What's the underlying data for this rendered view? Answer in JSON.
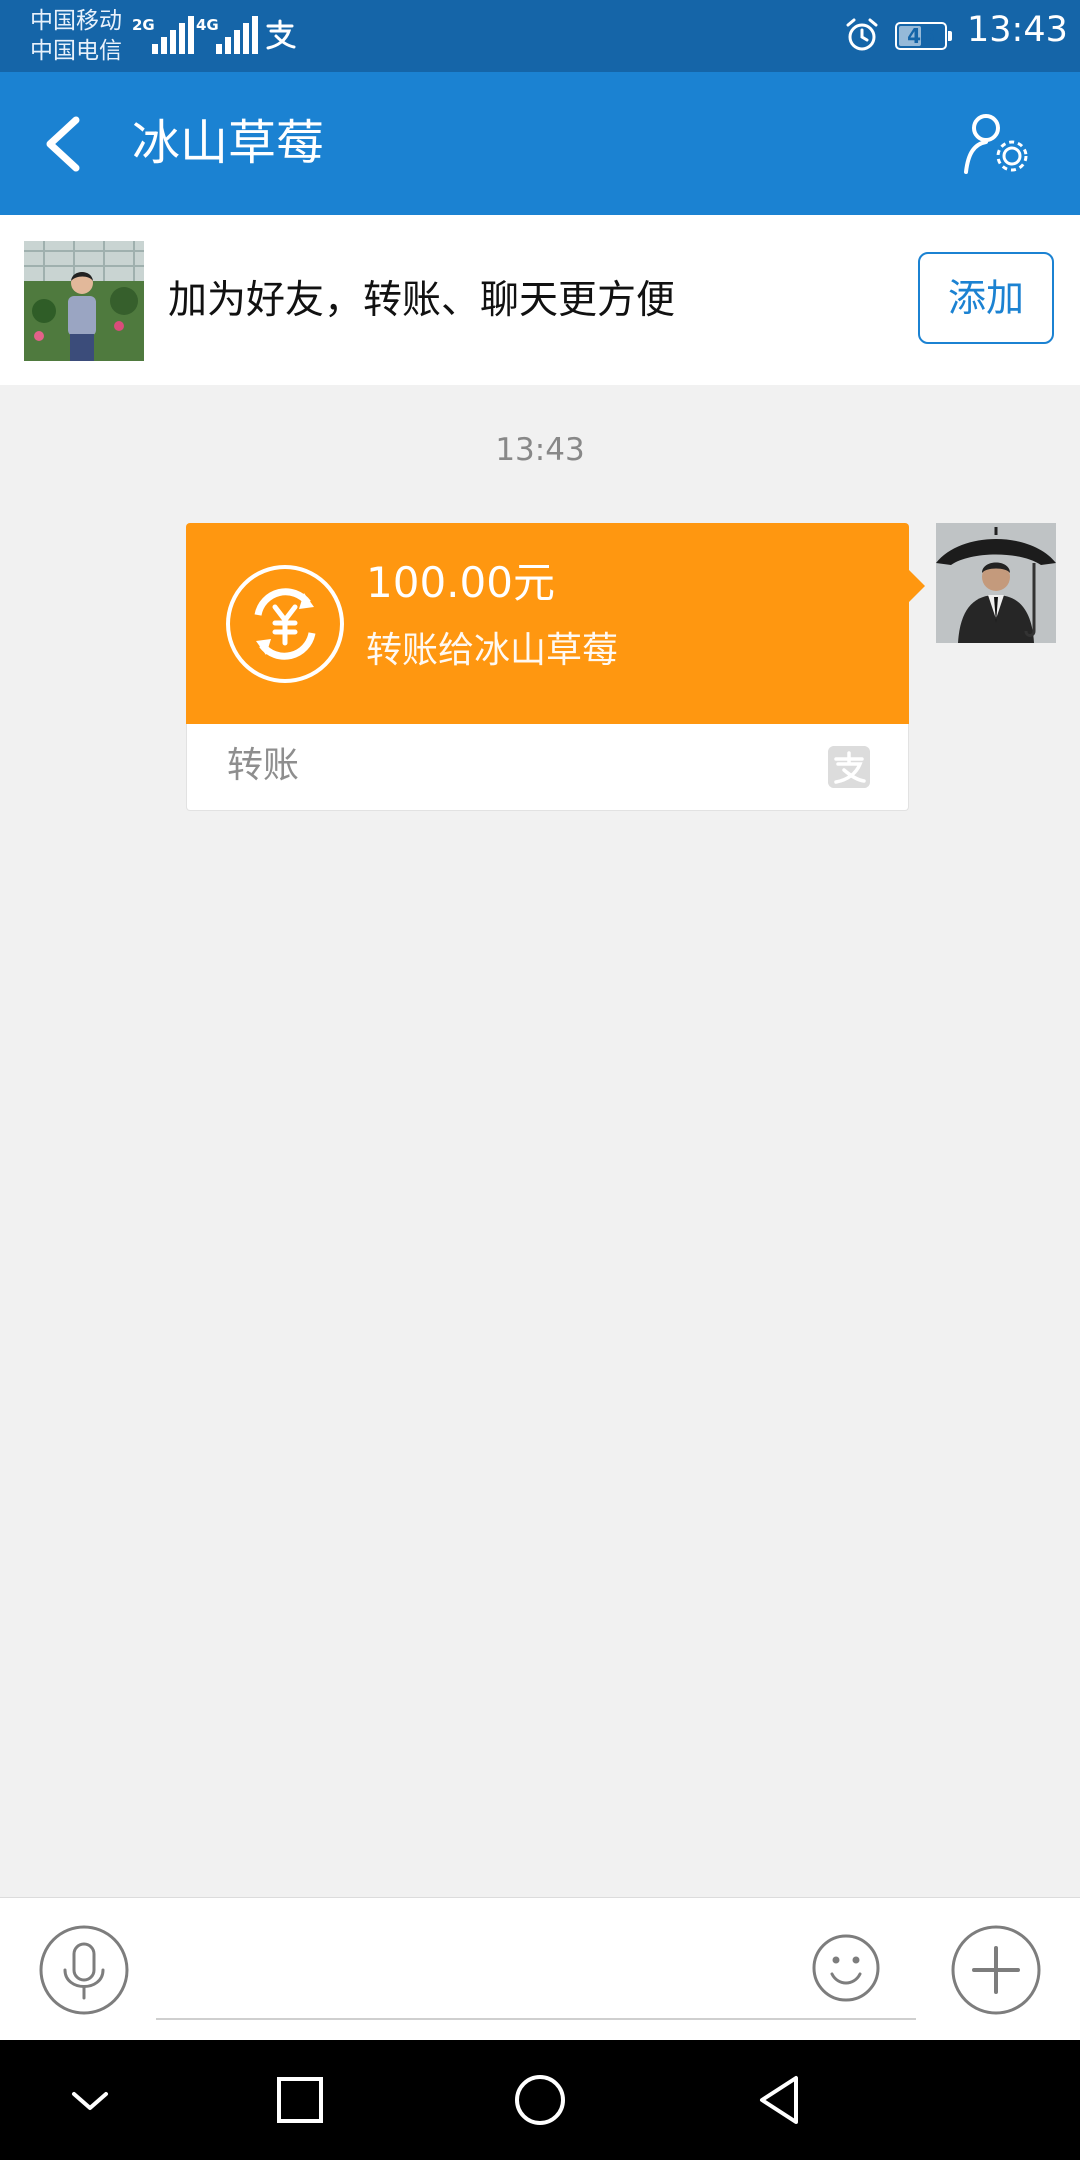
{
  "status_bar": {
    "carrier_1": "中国移动",
    "carrier_2": "中国电信",
    "signal_1_label": "2G",
    "signal_2_label": "4G",
    "battery": "46",
    "time": "13:43",
    "icons": [
      "alipay-icon",
      "alarm-icon"
    ]
  },
  "header": {
    "title": "冰山草莓",
    "back_icon": "chevron-left-icon",
    "settings_icon": "user-settings-icon"
  },
  "friend_bar": {
    "prompt": "加为好友，转账、聊天更方便",
    "add_label": "添加"
  },
  "chat": {
    "timestamp": "13:43",
    "transfer": {
      "amount": "100.00元",
      "description": "转账给冰山草莓",
      "label": "转账",
      "icon": "yuan-transfer-icon"
    }
  },
  "input_bar": {
    "placeholder": "",
    "icons": [
      "microphone-icon",
      "smile-icon",
      "plus-icon"
    ]
  },
  "nav_bar": {
    "icons": [
      "chevron-down-icon",
      "square-icon",
      "circle-icon",
      "triangle-back-icon"
    ]
  },
  "colors": {
    "status_bar": "#1565a8",
    "title_bar": "#1b82d2",
    "transfer_orange": "#ff9710",
    "background": "#f1f1f1"
  }
}
